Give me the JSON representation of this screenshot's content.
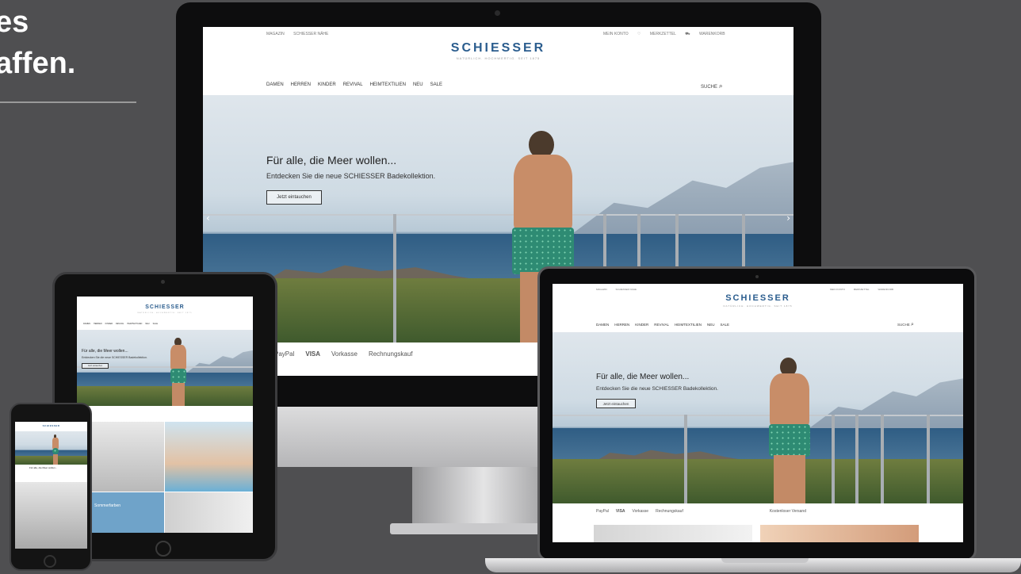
{
  "headline": {
    "line1": "es",
    "line2": "affen."
  },
  "site": {
    "util_left": [
      "MAGAZIN",
      "SCHIESSER NÄHE"
    ],
    "util_right": [
      "MEIN KONTO",
      "MERKZETTEL",
      "WARENKORB"
    ],
    "logo": "SCHIESSER",
    "tagline": "NATÜRLICH. HOCHWERTIG. SEIT 1875",
    "nav": [
      "DAMEN",
      "HERREN",
      "KINDER",
      "REVIVAL",
      "HEIMTEXTILIEN",
      "NEU",
      "SALE"
    ],
    "search": "SUCHE",
    "hero_title": "Für alle, die Meer wollen...",
    "hero_sub": "Entdecken Sie die neue SCHIESSER Badekollektion.",
    "hero_button": "Jetzt eintauchen",
    "payments": [
      "PayPal",
      "VISA",
      "Vorkasse",
      "Rechnungskauf"
    ],
    "pay_right": "Kostenloser Versand",
    "tile_label": "Sommerfarben"
  },
  "icons": {
    "search": "search-icon",
    "heart": "heart-icon",
    "cart": "cart-icon",
    "arrow_left": "chevron-left-icon",
    "arrow_right": "chevron-right-icon"
  },
  "colors": {
    "background": "#4f4f51",
    "brand": "#2b5d8e",
    "shorts": "#2e8b73"
  }
}
